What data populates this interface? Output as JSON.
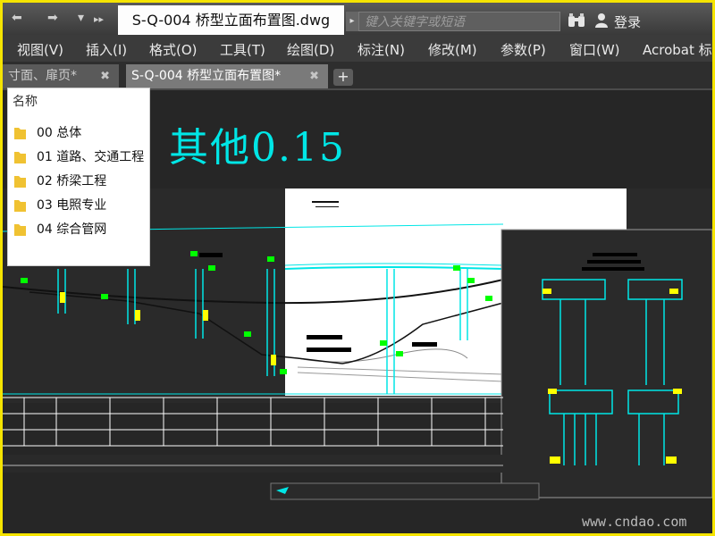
{
  "titlebar": {
    "back_glyph": "⬅",
    "forward_glyph": "➡",
    "dropdown_glyph": "▾",
    "expand_glyph": "▸▸",
    "document_title": "S-Q-004 桥型立面布置图.dwg",
    "search_placeholder": "键入关键字或短语",
    "search_arrow_glyph": "▸",
    "login_label": "登录"
  },
  "menubar": {
    "items": [
      "视图(V)",
      "插入(I)",
      "格式(O)",
      "工具(T)",
      "绘图(D)",
      "标注(N)",
      "修改(M)",
      "参数(P)",
      "窗口(W)",
      "Acrobat 标"
    ]
  },
  "tabs": {
    "items": [
      {
        "label": "寸面、扉页*",
        "close_glyph": "✖"
      },
      {
        "label": "S-Q-004 桥型立面布置图*",
        "close_glyph": "✖"
      }
    ],
    "add_glyph": "+"
  },
  "drawing": {
    "big_label": "3  其他0.15",
    "watermark": "www.cndao.com"
  },
  "folder_popup": {
    "header": "名称",
    "items": [
      "00 总体",
      "01 道路、交通工程",
      "02 桥梁工程",
      "03 电照专业",
      "04 综合管网"
    ]
  },
  "colors": {
    "frame_border": "#f5e400",
    "cad_cyan": "#00e6e6",
    "cad_green": "#00ff00",
    "cad_yellow": "#ffff00",
    "folder": "#f0c232"
  }
}
